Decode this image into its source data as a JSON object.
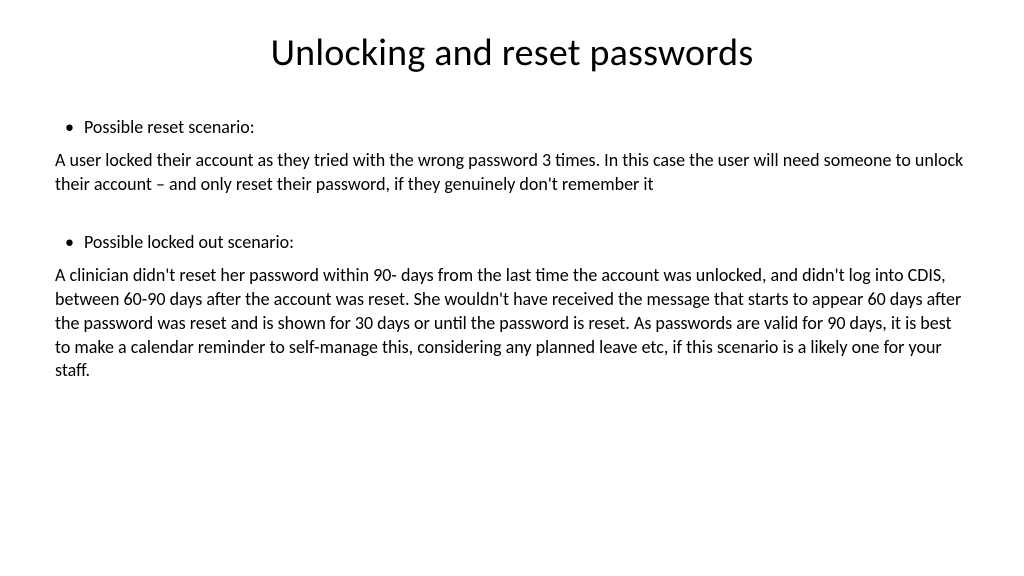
{
  "title": "Unlocking and reset passwords",
  "bullet1": {
    "label": "Possible reset scenario:"
  },
  "paragraph1": "A user locked their account as they tried with the wrong password 3 times. In this case the user will need someone to unlock their account – and only reset their password, if they genuinely don't remember it",
  "bullet2": {
    "label": "Possible locked out scenario:"
  },
  "paragraph2": "A clinician didn't reset her password within 90- days from the last time the account was unlocked, and didn't log into CDIS, between 60-90 days after the account was reset. She wouldn't have received the message that starts to appear 60 days after the password was reset and is shown for 30 days or until the password is reset. As passwords are valid for 90 days, it is best to make a calendar reminder to self-manage this, considering any planned leave etc, if this scenario is a likely one for your staff."
}
